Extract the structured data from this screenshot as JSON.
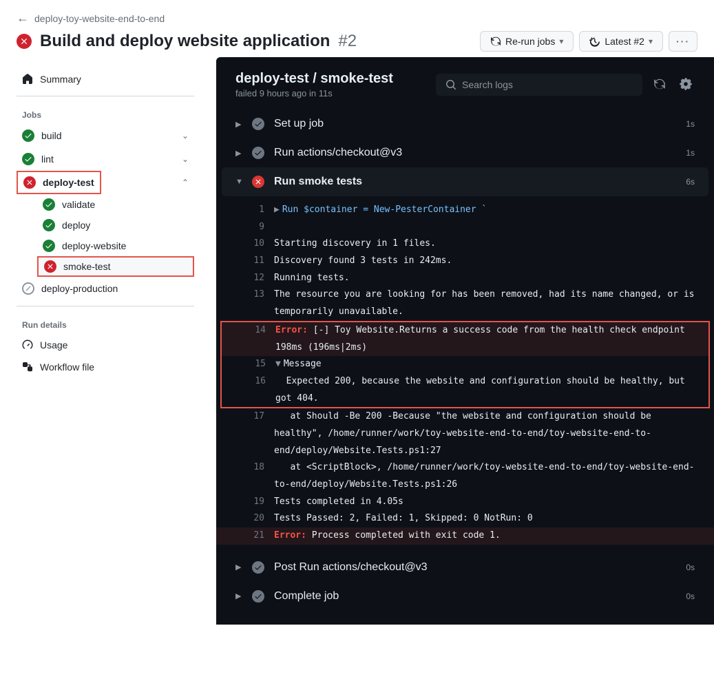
{
  "breadcrumb": {
    "workflow": "deploy-toy-website-end-to-end"
  },
  "title": {
    "text": "Build and deploy website application",
    "number": "#2"
  },
  "actions": {
    "rerun": "Re-run jobs",
    "latest": "Latest #2"
  },
  "sidebar": {
    "summary": "Summary",
    "jobs_label": "Jobs",
    "jobs": [
      {
        "name": "build",
        "status": "success",
        "expandable": true
      },
      {
        "name": "lint",
        "status": "success",
        "expandable": true
      },
      {
        "name": "deploy-test",
        "status": "fail",
        "expandable": true,
        "expanded": true,
        "children": [
          {
            "name": "validate",
            "status": "success"
          },
          {
            "name": "deploy",
            "status": "success"
          },
          {
            "name": "deploy-website",
            "status": "success"
          },
          {
            "name": "smoke-test",
            "status": "fail",
            "selected": true
          }
        ]
      },
      {
        "name": "deploy-production",
        "status": "skip"
      }
    ],
    "run_details_label": "Run details",
    "usage": "Usage",
    "workflow_file": "Workflow file"
  },
  "content": {
    "title": "deploy-test / smoke-test",
    "subtitle": "failed 9 hours ago in 11s",
    "search_placeholder": "Search logs",
    "steps": [
      {
        "name": "Set up job",
        "status": "grey",
        "time": "1s",
        "expanded": false
      },
      {
        "name": "Run actions/checkout@v3",
        "status": "grey",
        "time": "1s",
        "expanded": false
      },
      {
        "name": "Run smoke tests",
        "status": "fail",
        "time": "6s",
        "expanded": true
      },
      {
        "name": "Post Run actions/checkout@v3",
        "status": "grey",
        "time": "0s",
        "expanded": false
      },
      {
        "name": "Complete job",
        "status": "grey",
        "time": "0s",
        "expanded": false
      }
    ],
    "log": {
      "l1": "Run $container = New-PesterContainer `",
      "l10": "Starting discovery in 1 files.",
      "l11": "Discovery found 3 tests in 242ms.",
      "l12": "Running tests.",
      "l13": "The resource you are looking for has been removed, had its name changed, or is temporarily unavailable.",
      "l14_err": "Error:",
      "l14": " [-] Toy Website.Returns a success code from the health check endpoint 198ms (196ms|2ms)",
      "l15": "Message",
      "l16": "  Expected 200, because the website and configuration should be healthy, but got 404.",
      "l17": "   at Should -Be 200 -Because \"the website and configuration should be healthy\", /home/runner/work/toy-website-end-to-end/toy-website-end-to-end/deploy/Website.Tests.ps1:27",
      "l18": "   at <ScriptBlock>, /home/runner/work/toy-website-end-to-end/toy-website-end-to-end/deploy/Website.Tests.ps1:26",
      "l19": "Tests completed in 4.05s",
      "l20": "Tests Passed: 2, Failed: 1, Skipped: 0 NotRun: 0",
      "l21_err": "Error:",
      "l21": " Process completed with exit code 1."
    }
  }
}
